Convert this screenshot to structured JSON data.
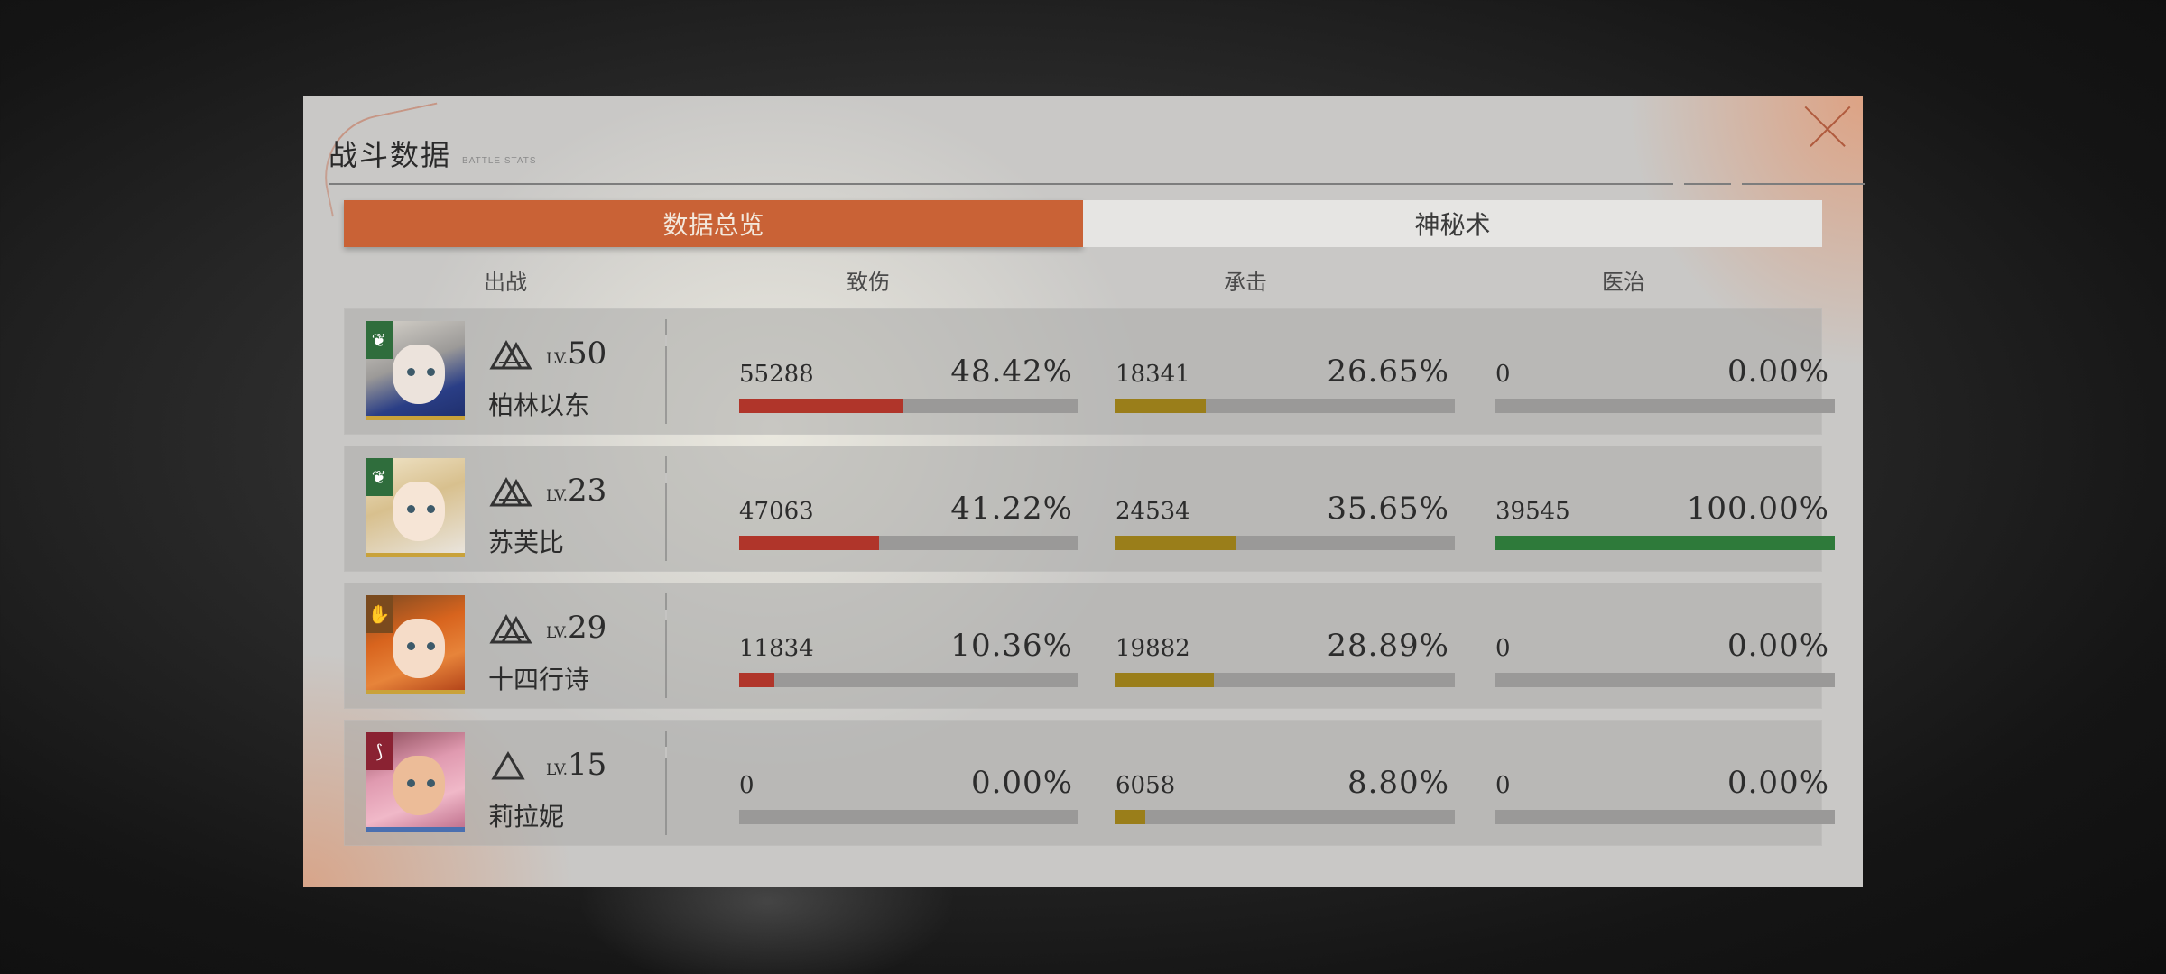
{
  "dialog": {
    "title": "战斗数据",
    "subtitle": "BATTLE STATS"
  },
  "tabs": [
    {
      "label": "数据总览",
      "active": true
    },
    {
      "label": "神秘术",
      "active": false
    }
  ],
  "columns": {
    "deploy": "出战",
    "damage": "致伤",
    "taken": "承击",
    "heal": "医治"
  },
  "colors": {
    "accent": "#c96236",
    "damage": "#b0352a",
    "taken": "#9a7e1a",
    "heal": "#2e7a3a"
  },
  "rows": [
    {
      "name": "柏林以东",
      "lv_label": "LV.",
      "level": "50",
      "rank_icon": "double-triangle-icon",
      "badge_icon": "leaf-icon",
      "damage": {
        "value": "55288",
        "percent": "48.42%",
        "fraction": 0.4842
      },
      "taken": {
        "value": "18341",
        "percent": "26.65%",
        "fraction": 0.2665
      },
      "heal": {
        "value": "0",
        "percent": "0.00%",
        "fraction": 0
      }
    },
    {
      "name": "苏芙比",
      "lv_label": "LV.",
      "level": "23",
      "rank_icon": "double-triangle-icon",
      "badge_icon": "leaf-icon",
      "damage": {
        "value": "47063",
        "percent": "41.22%",
        "fraction": 0.4122
      },
      "taken": {
        "value": "24534",
        "percent": "35.65%",
        "fraction": 0.3565
      },
      "heal": {
        "value": "39545",
        "percent": "100.00%",
        "fraction": 1.0
      }
    },
    {
      "name": "十四行诗",
      "lv_label": "LV.",
      "level": "29",
      "rank_icon": "double-triangle-icon",
      "badge_icon": "hand-icon",
      "damage": {
        "value": "11834",
        "percent": "10.36%",
        "fraction": 0.1036
      },
      "taken": {
        "value": "19882",
        "percent": "28.89%",
        "fraction": 0.2889
      },
      "heal": {
        "value": "0",
        "percent": "0.00%",
        "fraction": 0
      }
    },
    {
      "name": "莉拉妮",
      "lv_label": "LV.",
      "level": "15",
      "rank_icon": "triangle-icon",
      "badge_icon": "claw-icon",
      "damage": {
        "value": "0",
        "percent": "0.00%",
        "fraction": 0
      },
      "taken": {
        "value": "6058",
        "percent": "8.80%",
        "fraction": 0.088
      },
      "heal": {
        "value": "0",
        "percent": "0.00%",
        "fraction": 0
      }
    }
  ]
}
